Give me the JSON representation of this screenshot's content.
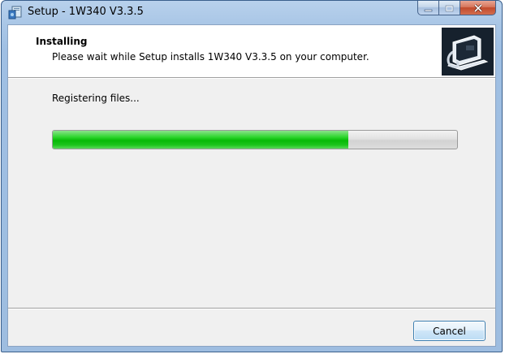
{
  "window": {
    "title": "Setup - 1W340 V3.3.5",
    "app_icon": "installer-icon",
    "caption_buttons": [
      "minimize-icon",
      "maximize-icon",
      "close-icon"
    ]
  },
  "header": {
    "title": "Installing",
    "subtitle": "Please wait while Setup installs 1W340 V3.3.5 on your computer.",
    "logo_icon": "computer-install-icon"
  },
  "status": {
    "text": "Registering files..."
  },
  "progress": {
    "value": 0.73,
    "fill_color": "#10c010"
  },
  "footer": {
    "cancel_label": "Cancel"
  }
}
